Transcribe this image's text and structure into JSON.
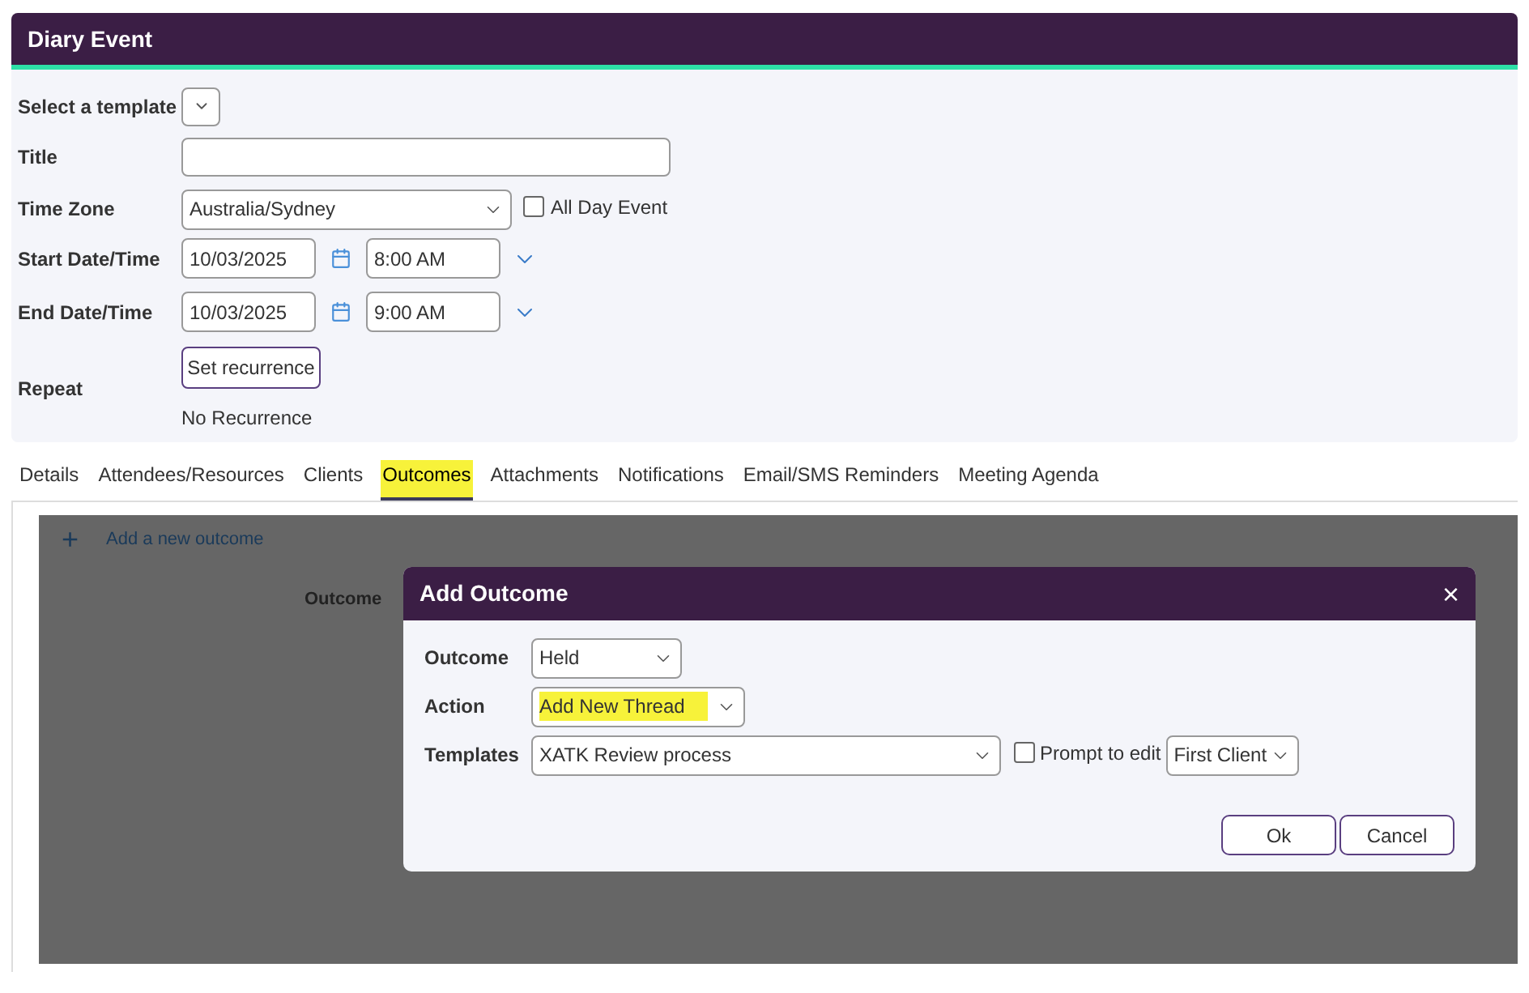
{
  "window": {
    "title": "Diary Event"
  },
  "form": {
    "template_label": "Select a template",
    "title_label": "Title",
    "timezone_label": "Time Zone",
    "timezone": "Australia/Sydney",
    "all_day": {
      "label": "All Day Event",
      "checked": false
    },
    "start": {
      "label": "Start Date/Time",
      "date": "10/03/2025",
      "time": "8:00 AM"
    },
    "end": {
      "label": "End Date/Time",
      "date": "10/03/2025",
      "time": "9:00 AM"
    },
    "repeat": {
      "label": "Repeat",
      "button": "Set recurrence",
      "status": "No Recurrence"
    }
  },
  "tabs": [
    {
      "label": "Details",
      "selected": false,
      "highlighted": false
    },
    {
      "label": "Attendees/Resources",
      "selected": false,
      "highlighted": false
    },
    {
      "label": "Clients",
      "selected": false,
      "highlighted": false
    },
    {
      "label": "Outcomes",
      "selected": true,
      "highlighted": true
    },
    {
      "label": "Attachments",
      "selected": false,
      "highlighted": false
    },
    {
      "label": "Notifications",
      "selected": false,
      "highlighted": false
    },
    {
      "label": "Email/SMS Reminders",
      "selected": false,
      "highlighted": false
    },
    {
      "label": "Meeting Agenda",
      "selected": false,
      "highlighted": false
    }
  ],
  "outcomes_panel": {
    "add_link": "+",
    "add_label": "Add a new outcome",
    "outcome_label": "Outcome"
  },
  "dialog": {
    "title": "Add Outcome",
    "close": "×",
    "outcome": {
      "label": "Outcome",
      "value": "Held",
      "highlighted": false
    },
    "action": {
      "label": "Action",
      "value": "Add New Thread",
      "highlighted": true
    },
    "templates": {
      "label": "Templates",
      "value": "XATK Review process"
    },
    "prompt": {
      "label": "Prompt to edit",
      "checked": false
    },
    "client": "First Client",
    "buttons": [
      "Ok",
      "Cancel"
    ]
  }
}
